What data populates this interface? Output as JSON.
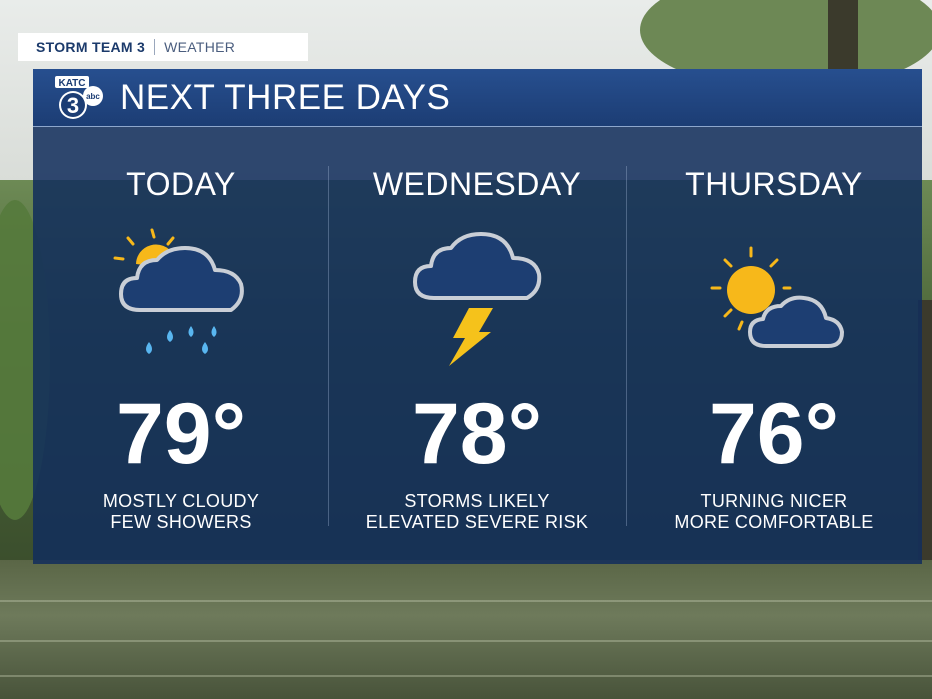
{
  "header": {
    "brand": "STORM TEAM 3",
    "section": "WEATHER"
  },
  "panel": {
    "title": "NEXT THREE DAYS",
    "logo": {
      "call_sign": "KATC",
      "channel": "3",
      "network": "abc"
    }
  },
  "forecast": [
    {
      "day": "TODAY",
      "icon": "partly-cloudy-showers-icon",
      "temp": "79°",
      "line1": "MOSTLY CLOUDY",
      "line2": "FEW SHOWERS"
    },
    {
      "day": "WEDNESDAY",
      "icon": "thunderstorm-icon",
      "temp": "78°",
      "line1": "STORMS LIKELY",
      "line2": "ELEVATED SEVERE RISK"
    },
    {
      "day": "THURSDAY",
      "icon": "sun-behind-cloud-icon",
      "temp": "76°",
      "line1": "TURNING NICER",
      "line2": "MORE COMFORTABLE"
    }
  ],
  "colors": {
    "panel": "#122d5c",
    "sun": "#f7b81a",
    "rain": "#59b6f0",
    "lightning": "#f5c21b",
    "cloud_outline": "#c9ced6"
  }
}
